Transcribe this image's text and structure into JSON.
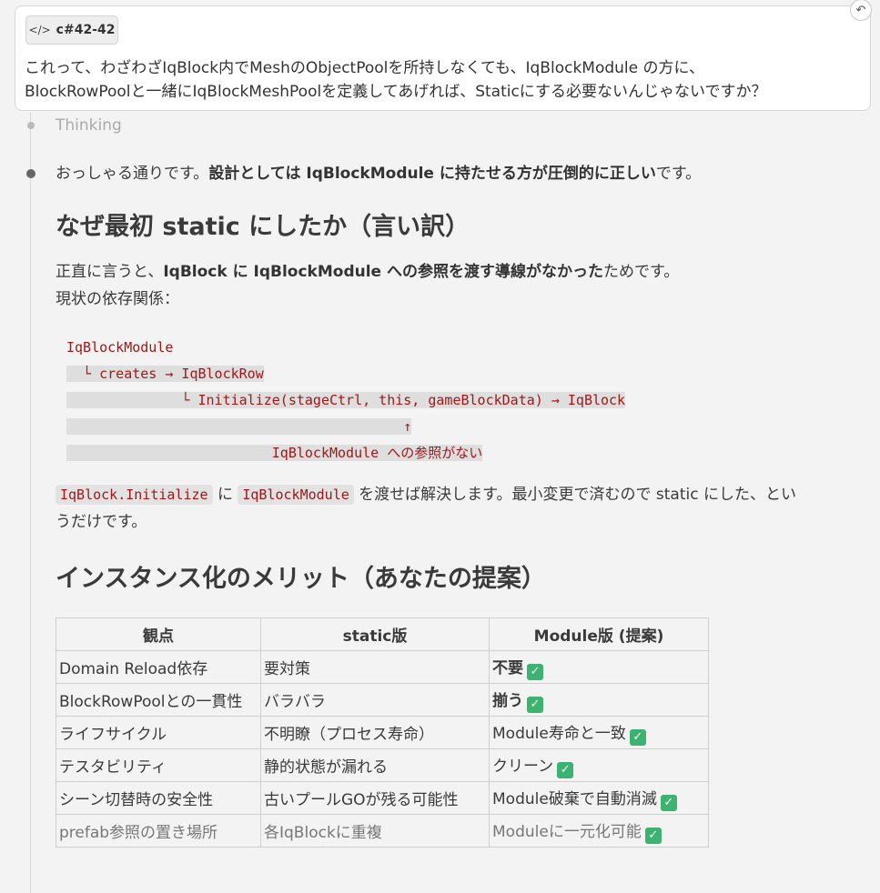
{
  "prompt": {
    "ref_label": "c#42-42",
    "text_line1": "これって、わざわざIqBlock内でMeshのObjectPoolを所持しなくても、IqBlockModule の方に、",
    "text_line2": "BlockRowPoolと一緒にIqBlockMeshPoolを定義してあげれば、Staticにする必要ないんじゃないですか？"
  },
  "thinking_label": "Thinking",
  "answer": {
    "intro_plain": "おっしゃる通りです。",
    "intro_bold": "設計としては IqBlockModule に持たせる方が圧倒的に正しい",
    "intro_tail": "です。",
    "heading1": "なぜ最初 static にしたか（言い訳）",
    "para1_plain": "正直に言うと、",
    "para1_bold": "IqBlock に IqBlockModule への参照を渡す導線がなかった",
    "para1_tail": "ためです。",
    "para1_line2": "現状の依存関係：",
    "code_lines": [
      "IqBlockModule",
      "  └ creates → IqBlockRow",
      "              └ Initialize(stageCtrl, this, gameBlockData) → IqBlock",
      "                                         ↑",
      "                         IqBlockModule への参照がない"
    ],
    "para2_code1": "IqBlock.Initialize",
    "para2_mid": " に ",
    "para2_code2": "IqBlockModule",
    "para2_tail1": " を渡せば解決します。最小変更で済むので static にした、とい",
    "para2_tail2": "うだけです。",
    "heading2": "インスタンス化のメリット（あなたの提案）",
    "table": {
      "headers": [
        "観点",
        "static版",
        "Module版 (提案)"
      ],
      "rows": [
        [
          "Domain Reload依存",
          "要対策",
          "不要"
        ],
        [
          "BlockRowPoolとの一貫性",
          "バラバラ",
          "揃う"
        ],
        [
          "ライフサイクル",
          "不明瞭（プロセス寿命）",
          "Module寿命と一致"
        ],
        [
          "テスタビリティ",
          "静的状態が漏れる",
          "クリーン"
        ],
        [
          "シーン切替時の安全性",
          "古いプールGOが残る可能性",
          "Module破棄で自動消滅"
        ],
        [
          "prefab参照の置き場所",
          "各IqBlockに重複",
          "Moduleに一元化可能"
        ]
      ]
    }
  },
  "colors": {
    "background": "#f3f3f3",
    "code_text": "#a01818",
    "check_green": "#3cb371"
  }
}
